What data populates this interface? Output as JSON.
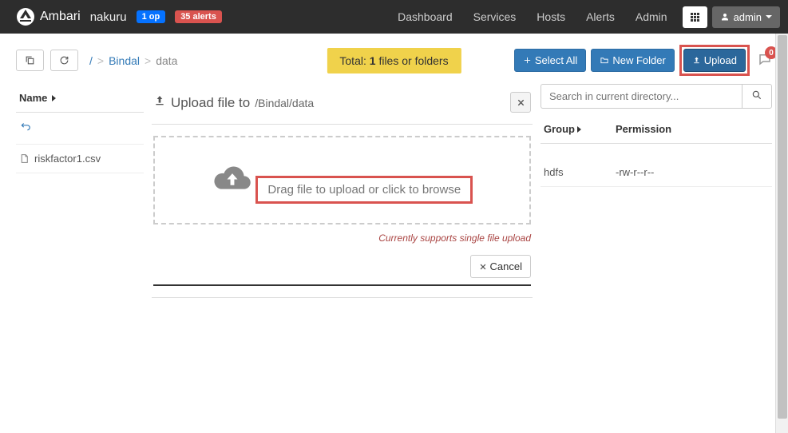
{
  "navbar": {
    "brand": "Ambari",
    "cluster": "nakuru",
    "ops_badge": "1 op",
    "alerts_badge": "35 alerts",
    "links": [
      "Dashboard",
      "Services",
      "Hosts",
      "Alerts",
      "Admin"
    ],
    "user_label": "admin"
  },
  "toolbar": {
    "breadcrumb": {
      "root": "/",
      "mid": "Bindal",
      "leaf": "data"
    },
    "totals_prefix": "Total: ",
    "totals_count": "1",
    "totals_suffix": " files or folders",
    "select_all": "Select All",
    "new_folder": "New Folder",
    "upload": "Upload",
    "notif_count": "0"
  },
  "columns": {
    "name": "Name",
    "group": "Group",
    "permission": "Permission"
  },
  "files": [
    {
      "name": "riskfactor1.csv",
      "group": "hdfs",
      "permission": "-rw-r--r--"
    }
  ],
  "upload_modal": {
    "title_prefix": "Upload file to",
    "path": "/Bindal/data",
    "drop_text": "Drag file to upload or click to browse",
    "support_note": "Currently supports single file upload",
    "cancel": "Cancel"
  },
  "search": {
    "placeholder": "Search in current directory..."
  }
}
